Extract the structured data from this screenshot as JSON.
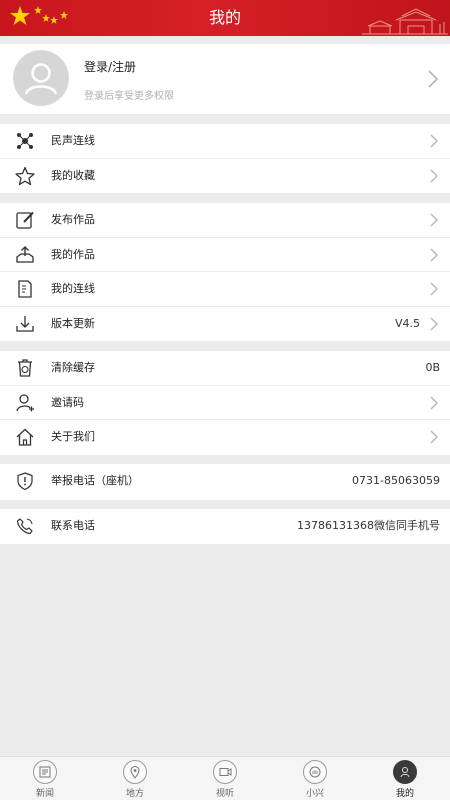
{
  "header": {
    "title": "我的"
  },
  "profile": {
    "login_label": "登录/注册",
    "hint": "登录后享受更多权限"
  },
  "group1": [
    {
      "label": "民声连线",
      "icon": "network-icon"
    },
    {
      "label": "我的收藏",
      "icon": "star-icon"
    }
  ],
  "group2": [
    {
      "label": "发布作品",
      "icon": "edit-icon"
    },
    {
      "label": "我的作品",
      "icon": "upload-tray-icon"
    },
    {
      "label": "我的连线",
      "icon": "document-icon"
    },
    {
      "label": "版本更新",
      "icon": "download-icon",
      "value": "V4.5"
    }
  ],
  "group3": [
    {
      "label": "清除缓存",
      "icon": "trash-icon",
      "value": "0B"
    },
    {
      "label": "邀请码",
      "icon": "user-add-icon"
    },
    {
      "label": "关于我们",
      "icon": "home-icon"
    }
  ],
  "report": {
    "label": "举报电话（座机）",
    "value": "0731-85063059"
  },
  "contact": {
    "label": "联系电话",
    "value": "13786131368微信同手机号"
  },
  "tabbar": [
    {
      "label": "新闻",
      "icon": "news-icon"
    },
    {
      "label": "地方",
      "icon": "location-icon"
    },
    {
      "label": "视听",
      "icon": "video-icon"
    },
    {
      "label": "小兴",
      "icon": "assistant-icon"
    },
    {
      "label": "我的",
      "icon": "profile-icon",
      "active": true
    }
  ]
}
